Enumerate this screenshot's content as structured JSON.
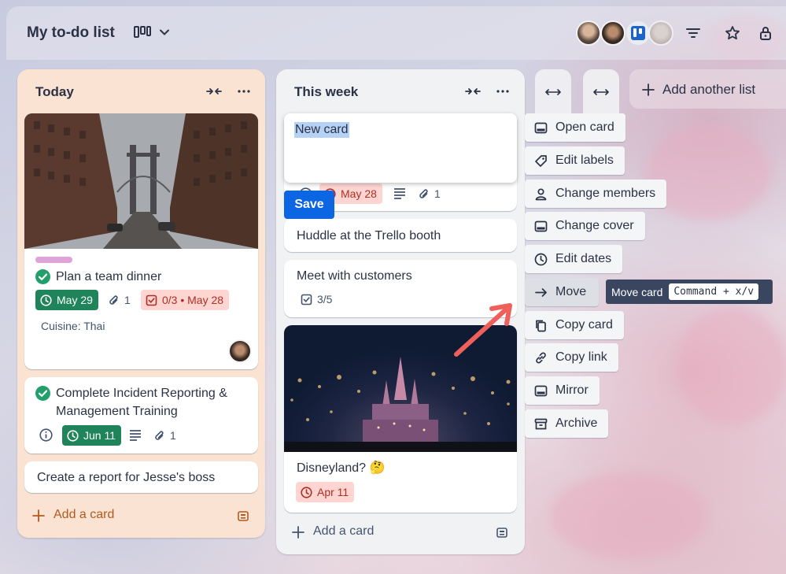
{
  "board": {
    "title": "My to-do list"
  },
  "lists": [
    {
      "title": "Today",
      "cards": [
        {
          "title": "Plan a team dinner",
          "due": "May 29",
          "attachments": "1",
          "checklist": "0/3 • May 28",
          "field": "Cuisine: Thai"
        },
        {
          "title_line1": "Complete Incident Reporting &",
          "title_line2": "Management Training",
          "due": "Jun 11",
          "attachments": "1"
        },
        {
          "title": "Create a report for Jesse's boss"
        }
      ],
      "add_card": "Add a card"
    },
    {
      "title": "This week",
      "editing_card": {
        "value": "New card",
        "due": "May 28",
        "attachments": "1",
        "save_label": "Save"
      },
      "cards": [
        {
          "title": "Huddle at the Trello booth"
        },
        {
          "title": "Meet with customers",
          "checklist": "3/5"
        },
        {
          "title": "Disneyland? 🤔",
          "due": "Apr 11"
        }
      ],
      "add_card": "Add a card"
    }
  ],
  "add_list": "Add another list",
  "quick_menu": [
    {
      "label": "Open card",
      "icon": "card-icon"
    },
    {
      "label": "Edit labels",
      "icon": "tag-icon"
    },
    {
      "label": "Change members",
      "icon": "person-icon"
    },
    {
      "label": "Change cover",
      "icon": "cover-icon"
    },
    {
      "label": "Edit dates",
      "icon": "clock-icon"
    },
    {
      "label": "Move",
      "icon": "arrow-right-icon"
    },
    {
      "label": "Copy card",
      "icon": "copy-icon"
    },
    {
      "label": "Copy link",
      "icon": "link-icon"
    },
    {
      "label": "Mirror",
      "icon": "mirror-icon"
    },
    {
      "label": "Archive",
      "icon": "archive-icon"
    }
  ],
  "tooltip": {
    "label": "Move card",
    "shortcut": "Command + x/v"
  },
  "colors": {
    "accent": "#0c66e4",
    "due_green": "#1f845a",
    "due_red_bg": "#ffd5d2",
    "today_list_bg": "#fae3d2",
    "annotation_arrow": "#f0605a"
  }
}
